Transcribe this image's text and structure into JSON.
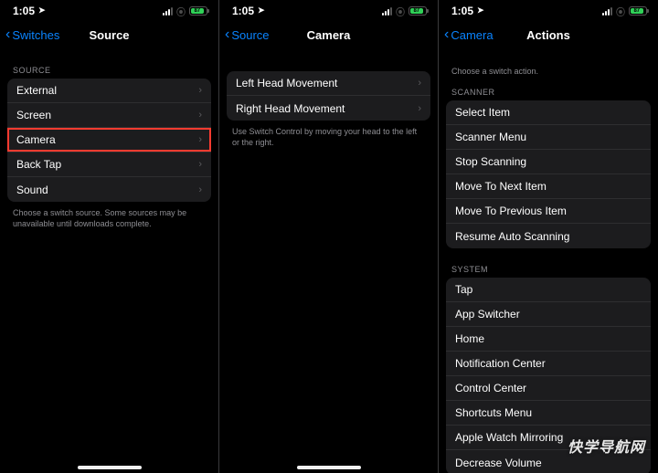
{
  "status": {
    "time": "1:05",
    "battery_pct": "87"
  },
  "screens": [
    {
      "back_label": "Switches",
      "title": "Source",
      "sections": [
        {
          "header": "SOURCE",
          "rows": [
            {
              "label": "External",
              "highlight": false,
              "disclosure": true
            },
            {
              "label": "Screen",
              "highlight": false,
              "disclosure": true
            },
            {
              "label": "Camera",
              "highlight": true,
              "disclosure": true
            },
            {
              "label": "Back Tap",
              "highlight": false,
              "disclosure": true
            },
            {
              "label": "Sound",
              "highlight": false,
              "disclosure": true
            }
          ],
          "footer": "Choose a switch source. Some sources may be unavailable until downloads complete."
        }
      ]
    },
    {
      "back_label": "Source",
      "title": "Camera",
      "sections": [
        {
          "header": "",
          "rows": [
            {
              "label": "Left Head Movement",
              "highlight": false,
              "disclosure": true
            },
            {
              "label": "Right Head Movement",
              "highlight": false,
              "disclosure": true
            }
          ],
          "footer": "Use Switch Control by moving your head to the left or the right."
        }
      ]
    },
    {
      "back_label": "Camera",
      "title": "Actions",
      "sections": [
        {
          "header": "",
          "rows": [],
          "pre_note": "Choose a switch action."
        },
        {
          "header": "SCANNER",
          "rows": [
            {
              "label": "Select Item",
              "highlight": false,
              "disclosure": false
            },
            {
              "label": "Scanner Menu",
              "highlight": false,
              "disclosure": false
            },
            {
              "label": "Stop Scanning",
              "highlight": false,
              "disclosure": false
            },
            {
              "label": "Move To Next Item",
              "highlight": false,
              "disclosure": false
            },
            {
              "label": "Move To Previous Item",
              "highlight": false,
              "disclosure": false
            },
            {
              "label": "Resume Auto Scanning",
              "highlight": false,
              "disclosure": false
            }
          ]
        },
        {
          "header": "SYSTEM",
          "rows": [
            {
              "label": "Tap",
              "highlight": false,
              "disclosure": false
            },
            {
              "label": "App Switcher",
              "highlight": false,
              "disclosure": false
            },
            {
              "label": "Home",
              "highlight": false,
              "disclosure": false
            },
            {
              "label": "Notification Center",
              "highlight": false,
              "disclosure": false
            },
            {
              "label": "Control Center",
              "highlight": false,
              "disclosure": false
            },
            {
              "label": "Shortcuts Menu",
              "highlight": false,
              "disclosure": false
            },
            {
              "label": "Apple Watch Mirroring",
              "highlight": false,
              "disclosure": false
            },
            {
              "label": "Decrease Volume",
              "highlight": false,
              "disclosure": false
            }
          ]
        }
      ]
    }
  ],
  "watermark": "快学导航网"
}
